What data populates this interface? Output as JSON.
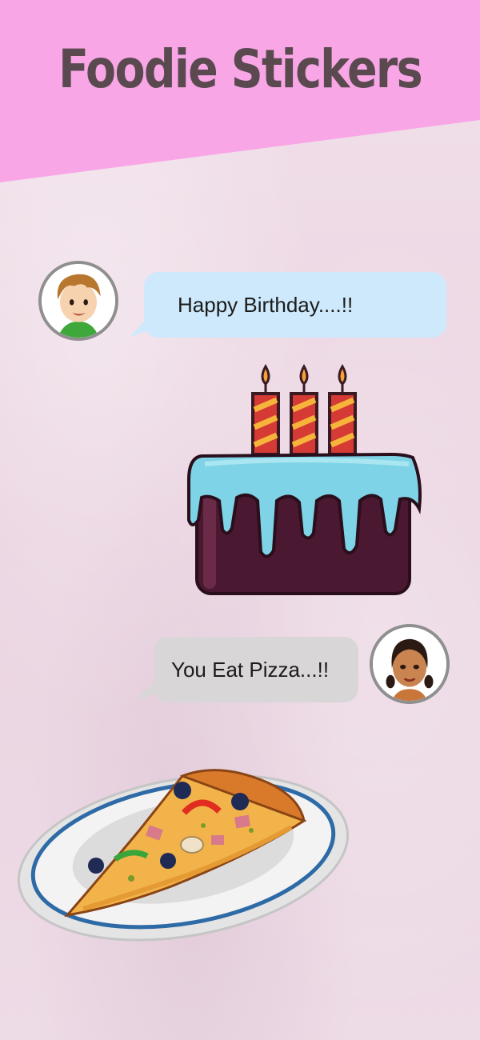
{
  "header": {
    "title": "Foodie Stickers",
    "banner_color": "#f9a6e7",
    "title_color": "#5a4a4f"
  },
  "chat": {
    "messages": [
      {
        "sender": "boy",
        "text": "Happy Birthday....!!",
        "bubble_color": "#cde9fb"
      },
      {
        "sender": "girl",
        "text": "You Eat Pizza...!!",
        "bubble_color": "#d9d6d8"
      }
    ],
    "stickers": [
      {
        "name": "birthday-cake-sticker"
      },
      {
        "name": "pizza-on-plate-sticker"
      }
    ]
  }
}
